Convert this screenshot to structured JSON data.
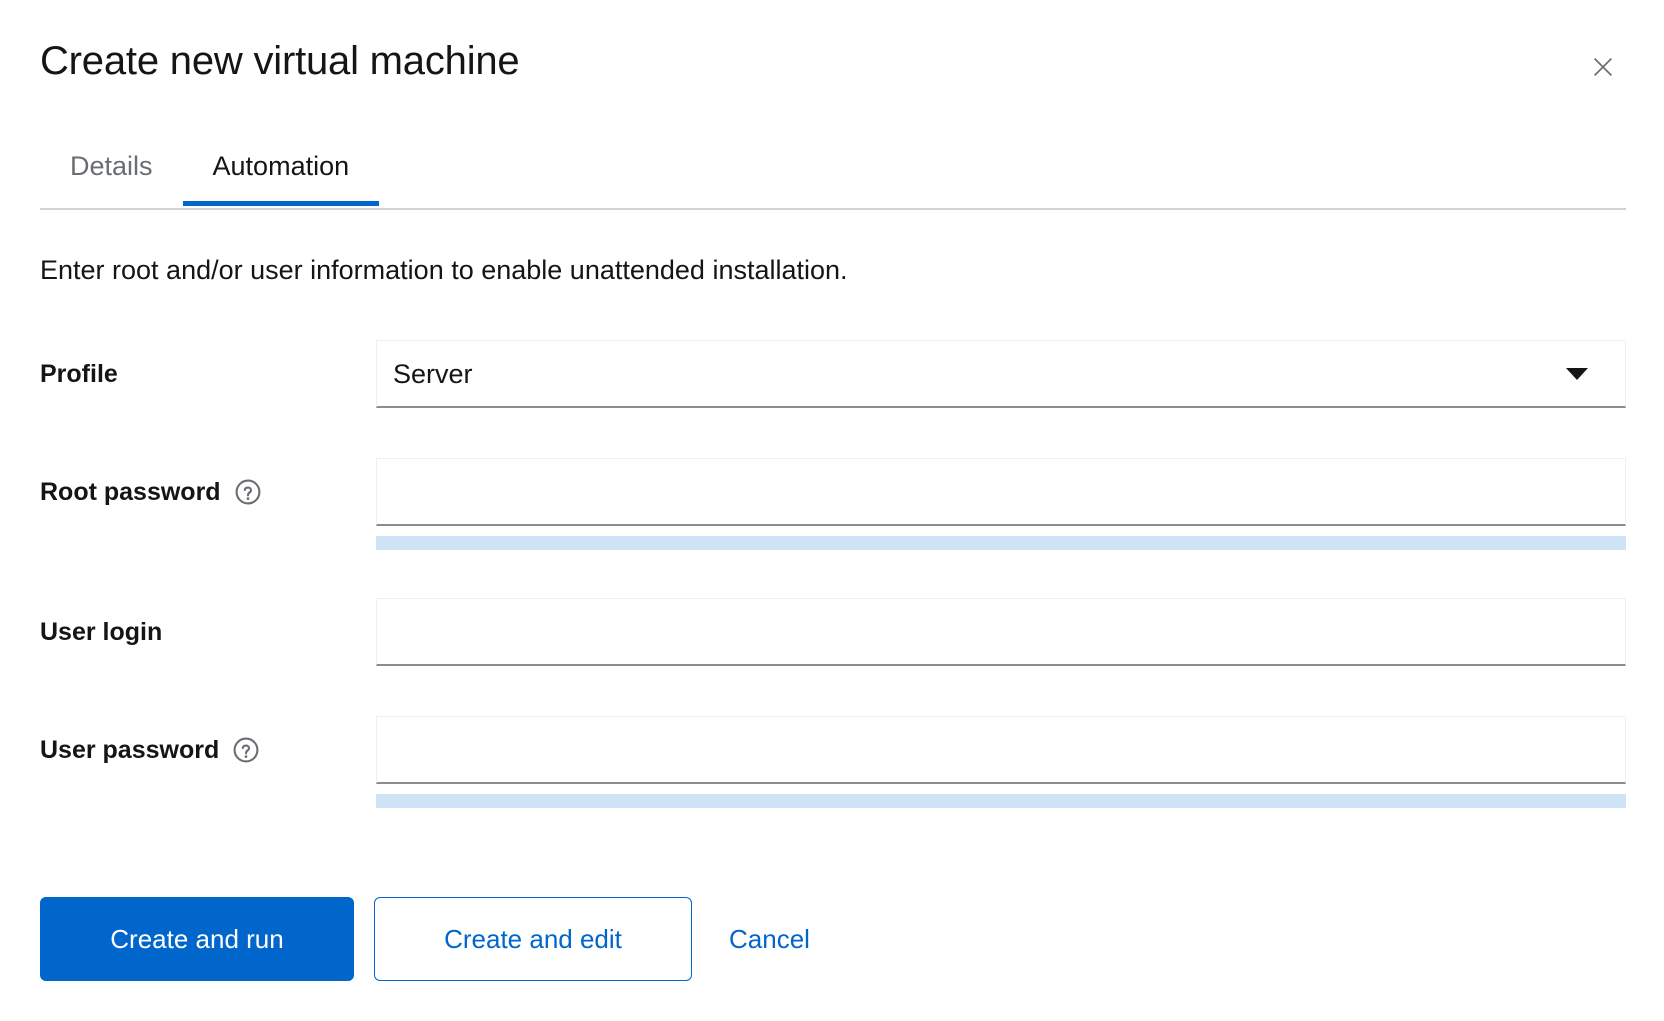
{
  "modal": {
    "title": "Create new virtual machine",
    "close_icon": "close-icon"
  },
  "tabs": [
    {
      "label": "Details",
      "active": false
    },
    {
      "label": "Automation",
      "active": true
    }
  ],
  "body": {
    "description": "Enter root and/or user information to enable unattended installation."
  },
  "fields": {
    "profile": {
      "label": "Profile",
      "value": "Server",
      "caret_icon": "chevron-down-icon"
    },
    "root_password": {
      "label": "Root password",
      "value": "",
      "placeholder": "",
      "help_icon": "help-circle-icon",
      "strength": ""
    },
    "user_login": {
      "label": "User login",
      "value": "",
      "placeholder": ""
    },
    "user_password": {
      "label": "User password",
      "value": "",
      "placeholder": "",
      "help_icon": "help-circle-icon",
      "strength": ""
    }
  },
  "footer": {
    "primary_label": "Create and run",
    "secondary_label": "Create and edit",
    "cancel_label": "Cancel"
  },
  "colors": {
    "accent": "#0066cc",
    "text": "#151515",
    "muted_text": "#6a6e73",
    "border": "#d2d2d2",
    "input_underline": "#8a8d90",
    "strength_track": "#cfe3f7"
  }
}
